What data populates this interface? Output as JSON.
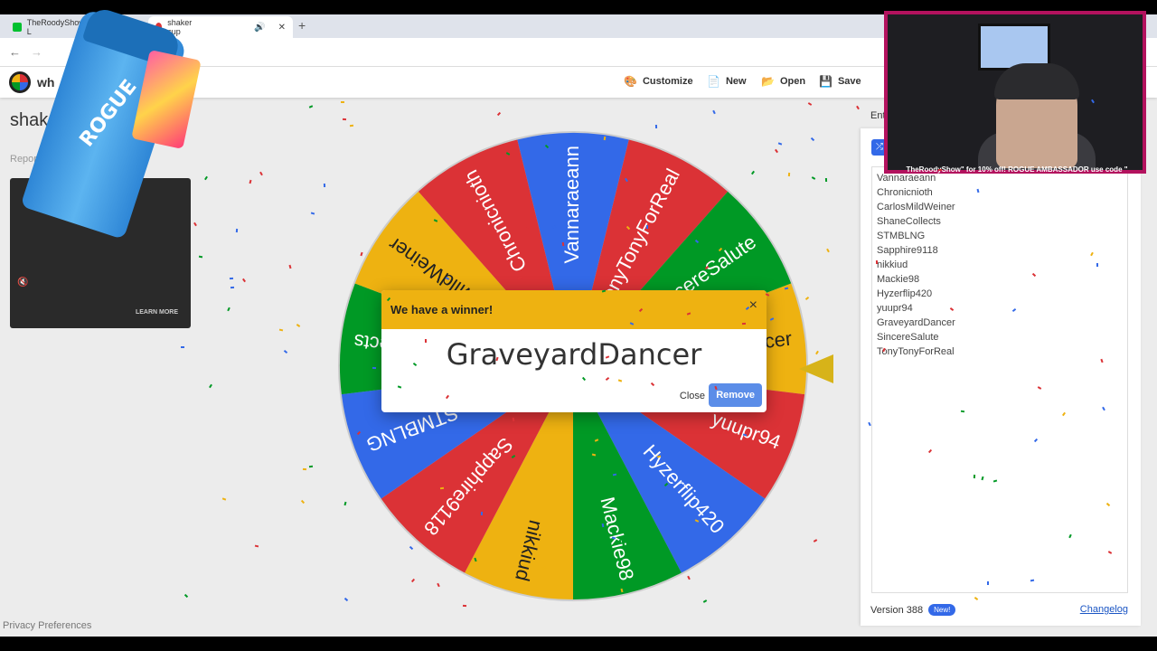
{
  "browser": {
    "tabs": [
      {
        "title": "TheRoodyShow - Watch L",
        "favicon_color": "#00c02f"
      },
      {
        "title": "shaker cup",
        "favicon_color": "#db3236"
      }
    ],
    "new_tab": "+"
  },
  "app": {
    "logo_text": "wh",
    "menu": [
      {
        "icon": "palette-icon",
        "label": "Customize"
      },
      {
        "icon": "file-icon",
        "label": "New"
      },
      {
        "icon": "folder-icon",
        "label": "Open"
      },
      {
        "icon": "save-icon",
        "label": "Save"
      }
    ],
    "page_title": "shake",
    "report_link": "Report bad a",
    "learn_more": "LEARN MORE",
    "privacy": "Privacy Preferences"
  },
  "wheel": {
    "segments": [
      {
        "name": "Vannaraeann",
        "color": "#3369e8"
      },
      {
        "name": "TonyTonyForReal",
        "color": "#db3236"
      },
      {
        "name": "SincereSalute",
        "color": "#009925"
      },
      {
        "name": "GraveyardDancer",
        "color": "#eeb211"
      },
      {
        "name": "yuupr94",
        "color": "#db3236"
      },
      {
        "name": "Hyzerflip420",
        "color": "#3369e8"
      },
      {
        "name": "Mackie98",
        "color": "#009925"
      },
      {
        "name": "nikkiud",
        "color": "#eeb211"
      },
      {
        "name": "Sapphire9118",
        "color": "#db3236"
      },
      {
        "name": "STMBLNG",
        "color": "#3369e8"
      },
      {
        "name": "ShaneCollects",
        "color": "#009925"
      },
      {
        "name": "CarlosMildWeiner",
        "color": "#eeb211"
      },
      {
        "name": "Chronicnioth",
        "color": "#db3236"
      }
    ]
  },
  "dialog": {
    "title": "We have a winner!",
    "close_x": "×",
    "winner": "GraveyardDancer",
    "close_label": "Close",
    "remove_label": "Remove"
  },
  "panel": {
    "tab_label": "Ent",
    "entries": [
      "Vannaraeann",
      "Chronicnioth",
      "CarlosMildWeiner",
      "ShaneCollects",
      "STMBLNG",
      "Sapphire9118",
      "nikkiud",
      "Mackie98",
      "Hyzerflip420",
      "yuupr94",
      "GraveyardDancer",
      "SincereSalute",
      "TonyTonyForReal"
    ],
    "version": "Version 388",
    "new_badge": "New!",
    "changelog": "Changelog"
  },
  "stream": {
    "ticker": "TheRoodyShow\" for 10% off!  ROGUE AMBASSADOR  use code \""
  },
  "overlay": {
    "brand": "ROGUE"
  }
}
